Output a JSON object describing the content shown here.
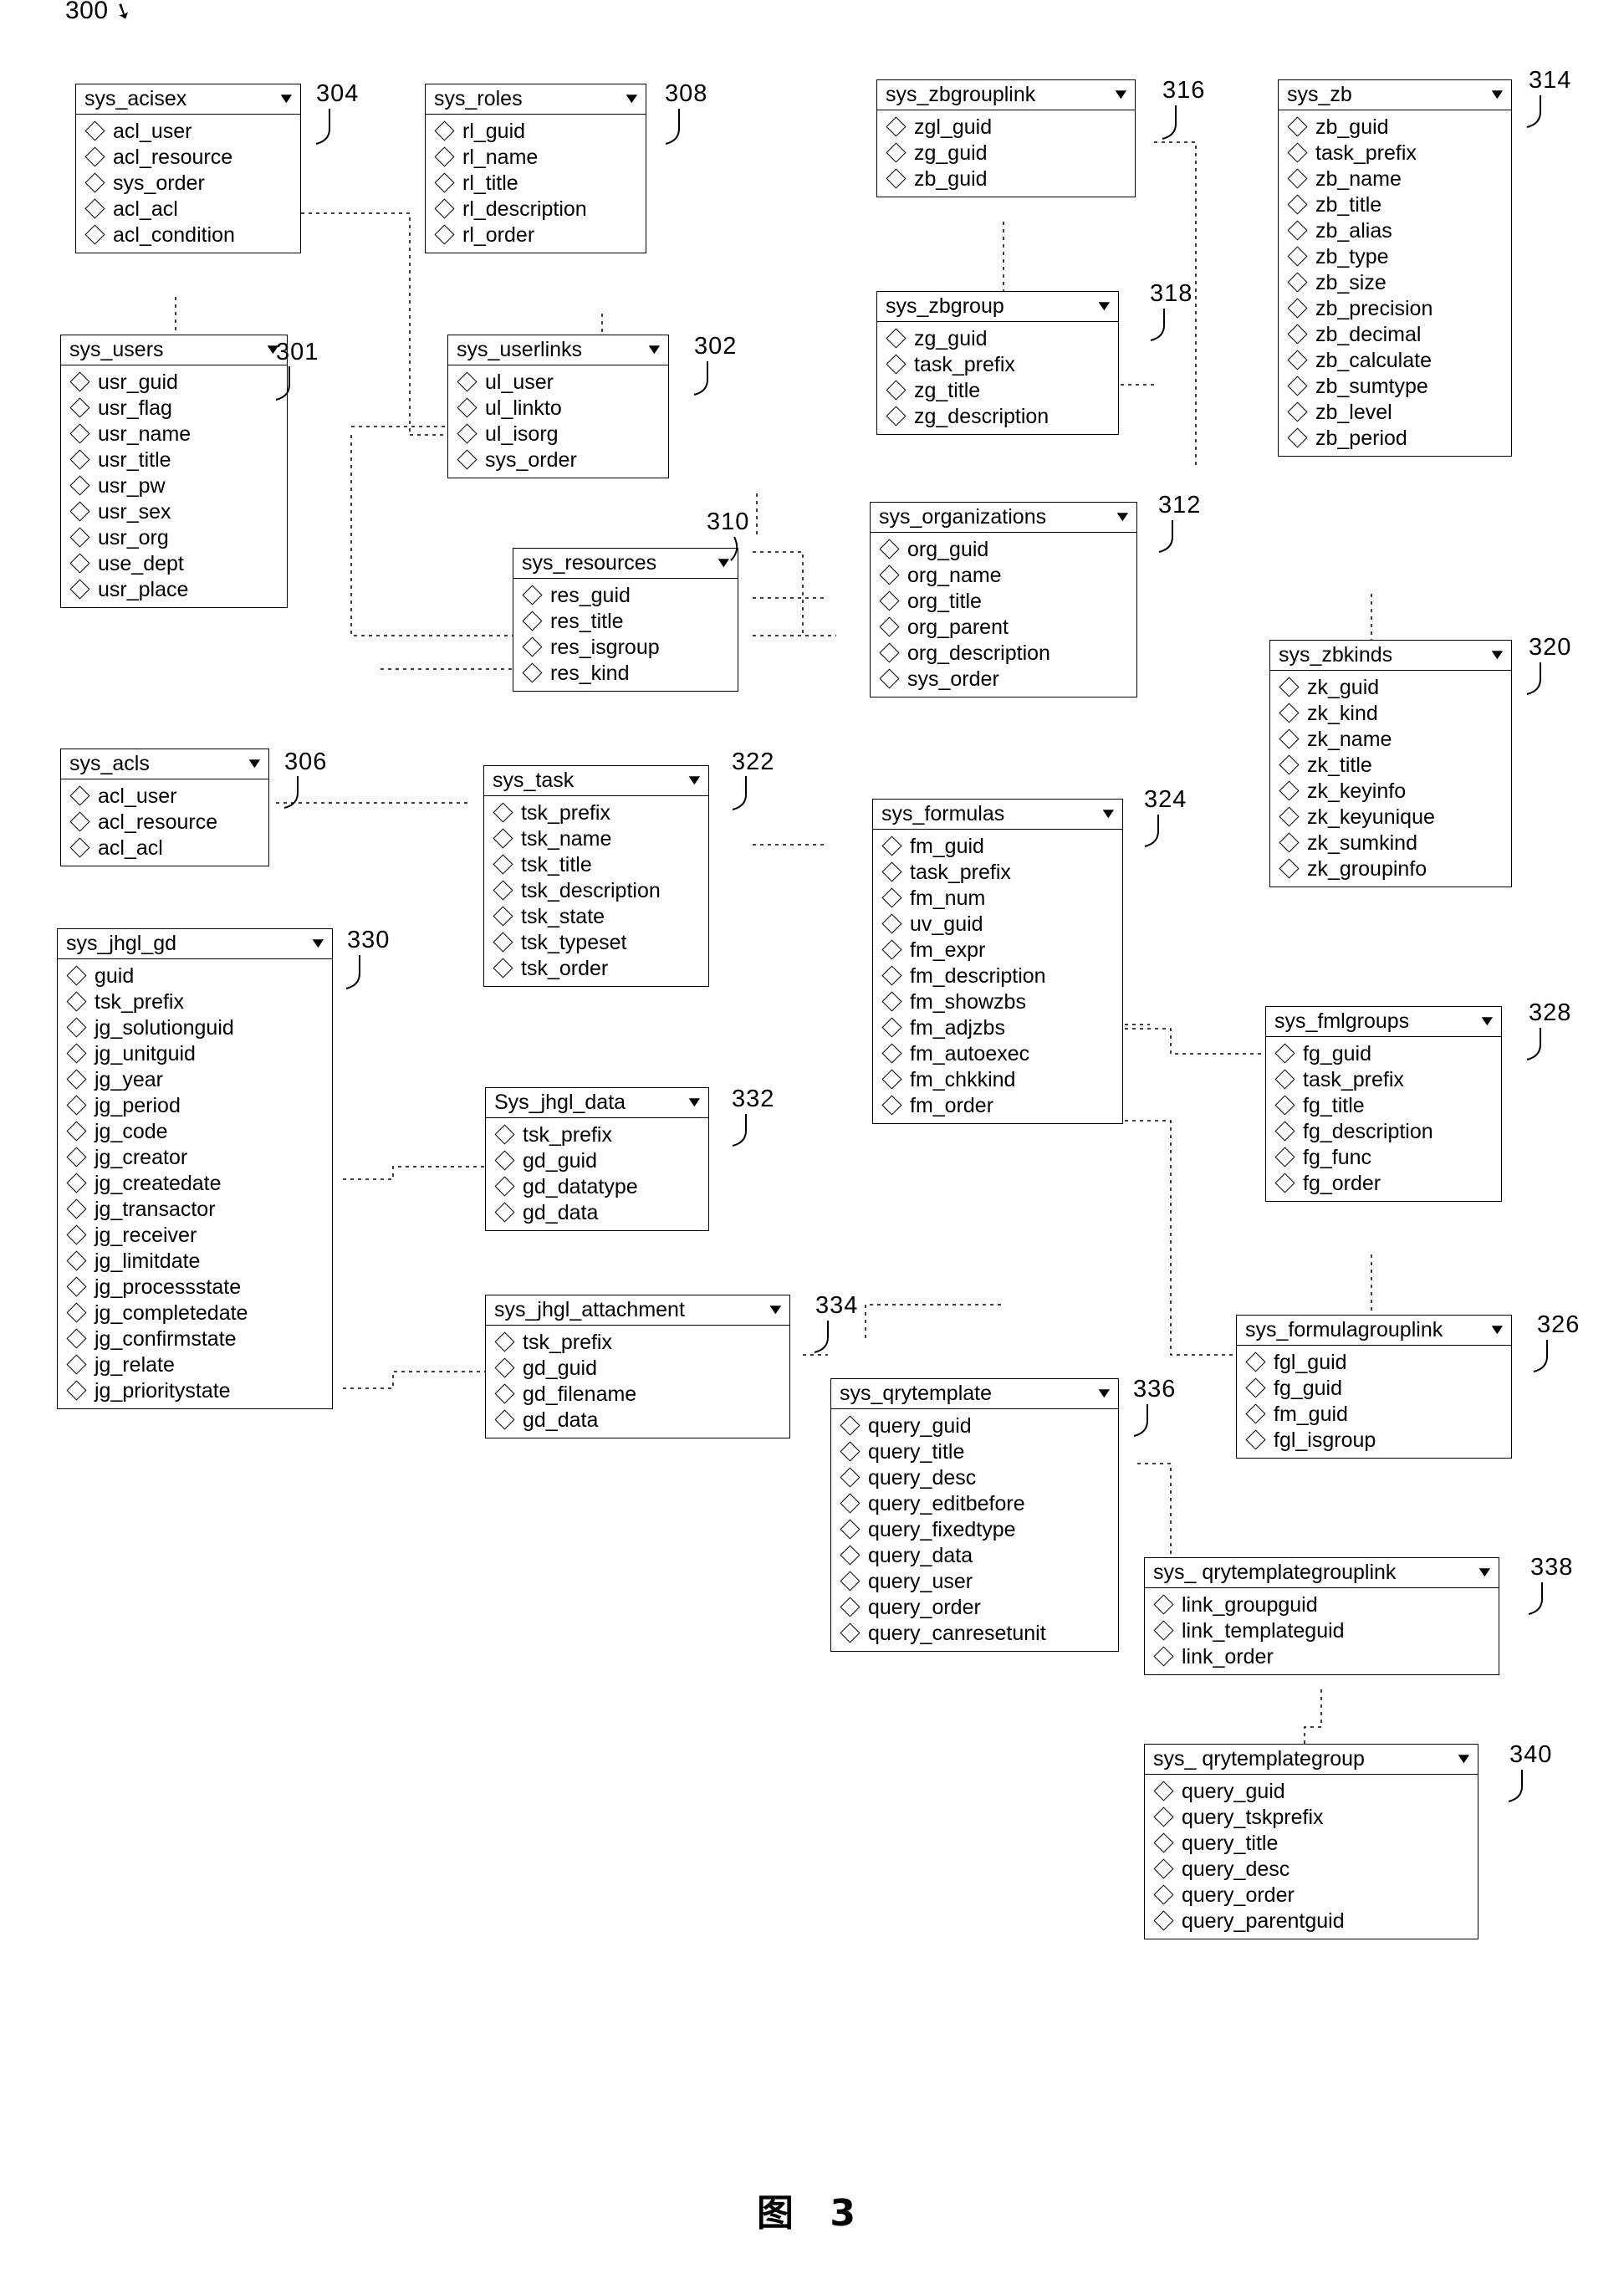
{
  "figure": {
    "ref_number": "300",
    "caption": "图 3"
  },
  "icons": {
    "caret": "▼",
    "field_marker": "diamond-icon"
  },
  "tables": [
    {
      "id": "sys_acisex",
      "name": "sys_acisex",
      "callout": "304",
      "fields": [
        "acl_user",
        "acl_resource",
        "sys_order",
        "acl_acl",
        "acl_condition"
      ]
    },
    {
      "id": "sys_users",
      "name": "sys_users",
      "callout": "301",
      "fields": [
        "usr_guid",
        "usr_flag",
        "usr_name",
        "usr_title",
        "usr_pw",
        "usr_sex",
        "usr_org",
        "use_dept",
        "usr_place"
      ]
    },
    {
      "id": "sys_acls",
      "name": "sys_acls",
      "callout": "306",
      "fields": [
        "acl_user",
        "acl_resource",
        "acl_acl"
      ]
    },
    {
      "id": "sys_jhgl_gd",
      "name": "sys_jhgl_gd",
      "callout": "330",
      "fields": [
        "guid",
        "tsk_prefix",
        "jg_solutionguid",
        "jg_unitguid",
        "jg_year",
        "jg_period",
        "jg_code",
        "jg_creator",
        "jg_createdate",
        "jg_transactor",
        "jg_receiver",
        "jg_limitdate",
        "jg_processstate",
        "jg_completedate",
        "jg_confirmstate",
        "jg_relate",
        "jg_prioritystate"
      ]
    },
    {
      "id": "sys_roles",
      "name": "sys_roles",
      "callout": "308",
      "fields": [
        "rl_guid",
        "rl_name",
        "rl_title",
        "rl_description",
        "rl_order"
      ]
    },
    {
      "id": "sys_userlinks",
      "name": "sys_userlinks",
      "callout": "302",
      "fields": [
        "ul_user",
        "ul_linkto",
        "ul_isorg",
        "sys_order"
      ]
    },
    {
      "id": "sys_resources",
      "name": "sys_resources",
      "callout": "310",
      "fields": [
        "res_guid",
        "res_title",
        "res_isgroup",
        "res_kind"
      ]
    },
    {
      "id": "sys_task",
      "name": "sys_task",
      "callout": "322",
      "fields": [
        "tsk_prefix",
        "tsk_name",
        "tsk_title",
        "tsk_description",
        "tsk_state",
        "tsk_typeset",
        "tsk_order"
      ]
    },
    {
      "id": "sys_jhgl_data",
      "name": "Sys_jhgl_data",
      "callout": "332",
      "fields": [
        "tsk_prefix",
        "gd_guid",
        "gd_datatype",
        "gd_data"
      ]
    },
    {
      "id": "sys_jhgl_attachment",
      "name": "sys_jhgl_attachment",
      "callout": "334",
      "fields": [
        "tsk_prefix",
        "gd_guid",
        "gd_filename",
        "gd_data"
      ]
    },
    {
      "id": "sys_zbgrouplink",
      "name": "sys_zbgrouplink",
      "callout": "316",
      "fields": [
        "zgl_guid",
        "zg_guid",
        "zb_guid"
      ]
    },
    {
      "id": "sys_zbgroup",
      "name": "sys_zbgroup",
      "callout": "318",
      "fields": [
        "zg_guid",
        "task_prefix",
        "zg_title",
        "zg_description"
      ]
    },
    {
      "id": "sys_organizations",
      "name": "sys_organizations",
      "callout": "312",
      "fields": [
        "org_guid",
        "org_name",
        "org_title",
        "org_parent",
        "org_description",
        "sys_order"
      ]
    },
    {
      "id": "sys_formulas",
      "name": "sys_formulas",
      "callout": "324",
      "fields": [
        "fm_guid",
        "task_prefix",
        "fm_num",
        "uv_guid",
        "fm_expr",
        "fm_description",
        "fm_showzbs",
        "fm_adjzbs",
        "fm_autoexec",
        "fm_chkkind",
        "fm_order"
      ]
    },
    {
      "id": "sys_qrytemplate",
      "name": "sys_qrytemplate",
      "callout": "336",
      "fields": [
        "query_guid",
        "query_title",
        "query_desc",
        "query_editbefore",
        "query_fixedtype",
        "query_data",
        "query_user",
        "query_order",
        "query_canresetunit"
      ]
    },
    {
      "id": "sys_zb",
      "name": "sys_zb",
      "callout": "314",
      "fields": [
        "zb_guid",
        "task_prefix",
        "zb_name",
        "zb_title",
        "zb_alias",
        "zb_type",
        "zb_size",
        "zb_precision",
        "zb_decimal",
        "zb_calculate",
        "zb_sumtype",
        "zb_level",
        "zb_period"
      ]
    },
    {
      "id": "sys_zbkinds",
      "name": "sys_zbkinds",
      "callout": "320",
      "fields": [
        "zk_guid",
        "zk_kind",
        "zk_name",
        "zk_title",
        "zk_keyinfo",
        "zk_keyunique",
        "zk_sumkind",
        "zk_groupinfo"
      ]
    },
    {
      "id": "sys_fmlgroups",
      "name": "sys_fmlgroups",
      "callout": "328",
      "fields": [
        "fg_guid",
        "task_prefix",
        "fg_title",
        "fg_description",
        "fg_func",
        "fg_order"
      ]
    },
    {
      "id": "sys_formulagrouplink",
      "name": "sys_formulagrouplink",
      "callout": "326",
      "fields": [
        "fgl_guid",
        "fg_guid",
        "fm_guid",
        "fgl_isgroup"
      ]
    },
    {
      "id": "sys_qrytemplategrouplink",
      "name": "sys_ qrytemplategrouplink",
      "callout": "338",
      "fields": [
        "link_groupguid",
        "link_templateguid",
        "link_order"
      ]
    },
    {
      "id": "sys_qrytemplategroup",
      "name": "sys_ qrytemplategroup",
      "callout": "340",
      "fields": [
        "query_guid",
        "query_tskprefix",
        "query_title",
        "query_desc",
        "query_order",
        "query_parentguid"
      ]
    }
  ]
}
